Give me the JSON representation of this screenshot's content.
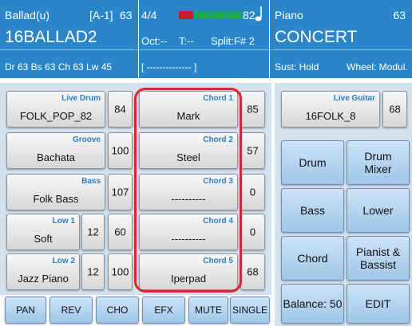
{
  "header": {
    "style": {
      "name": "Ballad(u)",
      "variation": "[A-1]",
      "volume": "63",
      "program": "16BALLAD2",
      "details": "Dr 63  Bs 63  Ch 63  Lw 45"
    },
    "mid": {
      "time_signature": "4/4",
      "tempo": "82",
      "tempo_icon": "note-icon",
      "beat_meter": [
        "red",
        "green",
        "green",
        "green"
      ],
      "octave": "Oct:--",
      "transpose": "T:--",
      "split": "Split:F# 2",
      "chord_display": "[ -------------- ]"
    },
    "voice": {
      "category": "Piano",
      "volume": "63",
      "name": "CONCERT",
      "sustain": "Sust: Hold",
      "wheel": "Wheel: Modul."
    }
  },
  "left_panel": {
    "live_drum": {
      "category": "Live Drum",
      "name": "FOLK_POP_82",
      "volume": "84"
    },
    "groove": {
      "category": "Groove",
      "name": "Bachata",
      "volume": "100"
    },
    "bass": {
      "category": "Bass",
      "name": "Folk Bass",
      "volume": "107"
    },
    "low1": {
      "category": "Low 1",
      "name": "Soft",
      "octave": "12",
      "volume": "60"
    },
    "low2": {
      "category": "Low 2",
      "name": "Jazz Piano",
      "octave": "12",
      "volume": "100"
    }
  },
  "chords": [
    {
      "category": "Chord 1",
      "name": "Mark",
      "volume": "85"
    },
    {
      "category": "Chord 2",
      "name": "Steel",
      "volume": "57"
    },
    {
      "category": "Chord 3",
      "name": "----------",
      "volume": "0"
    },
    {
      "category": "Chord 4",
      "name": "----------",
      "volume": "0"
    },
    {
      "category": "Chord 5",
      "name": "Iperpad",
      "volume": "68"
    }
  ],
  "right_panel": {
    "live_guitar": {
      "category": "Live Guitar",
      "name": "16FOLK_8",
      "volume": "68"
    },
    "buttons": {
      "drum": "Drum",
      "drum_mixer_1": "Drum",
      "drum_mixer_2": "Mixer",
      "bass": "Bass",
      "lower": "Lower",
      "chord": "Chord",
      "pianist_1": "Pianist &",
      "pianist_2": "Bassist",
      "balance": "Balance: 50",
      "edit": "EDIT"
    }
  },
  "bottom_bar": [
    "PAN",
    "REV",
    "CHO",
    "EFX",
    "MUTE",
    "SINGLE"
  ],
  "colors": {
    "header_blue": "#2a86c9",
    "accent_red": "#e0242c",
    "category_blue": "#2c7fc4"
  }
}
